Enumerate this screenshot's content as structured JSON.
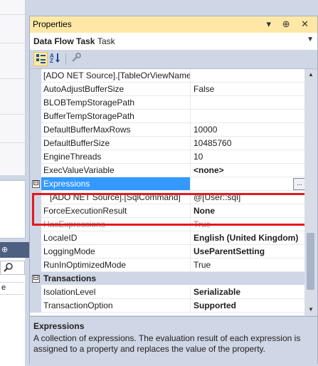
{
  "properties_window": {
    "title": "Properties",
    "title_buttons": "▾ ⊕ ✕",
    "object_name": "Data Flow Task",
    "object_type": "Task",
    "toolbar": {
      "categorized_icon": "categorized-icon",
      "alphabetical_icon": "alphabetical-icon",
      "property_pages_icon": "wrench-icon"
    },
    "rows": [
      {
        "name": "[ADO NET Source].[TableOrViewName",
        "value": ""
      },
      {
        "name": "AutoAdjustBufferSize",
        "value": "False"
      },
      {
        "name": "BLOBTempStoragePath",
        "value": ""
      },
      {
        "name": "BufferTempStoragePath",
        "value": ""
      },
      {
        "name": "DefaultBufferMaxRows",
        "value": "10000"
      },
      {
        "name": "DefaultBufferSize",
        "value": "10485760"
      },
      {
        "name": "EngineThreads",
        "value": "10"
      },
      {
        "name": "ExecValueVariable",
        "value": "<none>"
      },
      {
        "name": "Expressions",
        "value": "",
        "expander": "⊟"
      },
      {
        "name": "[ADO NET Source].[SqlCommand]",
        "value": "@[User::sql]"
      },
      {
        "name": "ForceExecutionResult",
        "value": "None"
      },
      {
        "name": "HasExpressions",
        "value": "True"
      },
      {
        "name": "LocaleID",
        "value": "English (United Kingdom)"
      },
      {
        "name": "LoggingMode",
        "value": "UseParentSetting"
      },
      {
        "name": "RunInOptimizedMode",
        "value": "True"
      },
      {
        "name": "Transactions",
        "value": "",
        "expander": "⊟"
      },
      {
        "name": "IsolationLevel",
        "value": "Serializable"
      },
      {
        "name": "TransactionOption",
        "value": "Supported"
      }
    ],
    "ellipsis_label": "...",
    "description": {
      "title": "Expressions",
      "text": "A collection of expressions. The evaluation result of each expression is assigned to a property and replaces the value of the property."
    }
  },
  "background": {
    "toolwin_pin": "⊕",
    "toolwin_search_icon": "search-icon",
    "list_cell": "e"
  },
  "colors": {
    "selection": "#3399ff",
    "highlight_box": "#e3191e",
    "title_active": "#ffe8a6"
  }
}
